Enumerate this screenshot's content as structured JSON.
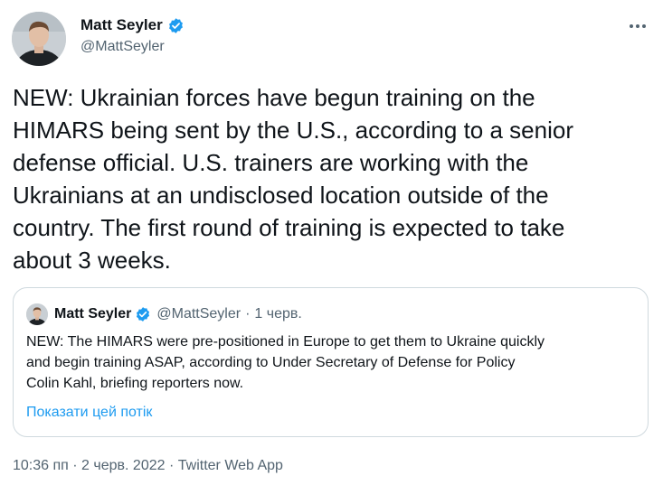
{
  "author": {
    "name": "Matt Seyler",
    "handle": "@MattSeyler"
  },
  "tweet": {
    "text": "NEW: Ukrainian forces have begun training on the\nHIMARS being sent by the U.S., according to a senior\ndefense official. U.S. trainers are working with the\nUkrainians at an undisclosed location outside of the\ncountry. The first round of training is expected to take\nabout 3 weeks."
  },
  "quote": {
    "name": "Matt Seyler",
    "handle": "@MattSeyler",
    "separator": "·",
    "date": "1 черв.",
    "text": "NEW: The HIMARS were pre-positioned in Europe to get them to Ukraine quickly\nand begin training ASAP, according to Under Secretary of Defense for Policy\nColin Kahl, briefing reporters now.",
    "show_thread": "Показати цей потік"
  },
  "meta": {
    "time": "10:36 пп",
    "sep1": "·",
    "date": "2 черв. 2022",
    "sep2": "·",
    "source": "Twitter Web App"
  },
  "icons": {
    "verified": "verified-badge-icon",
    "more": "more-options-icon"
  },
  "colors": {
    "text": "#0f1419",
    "secondary": "#536471",
    "link": "#1d9bf0",
    "border": "#cfd9de"
  }
}
